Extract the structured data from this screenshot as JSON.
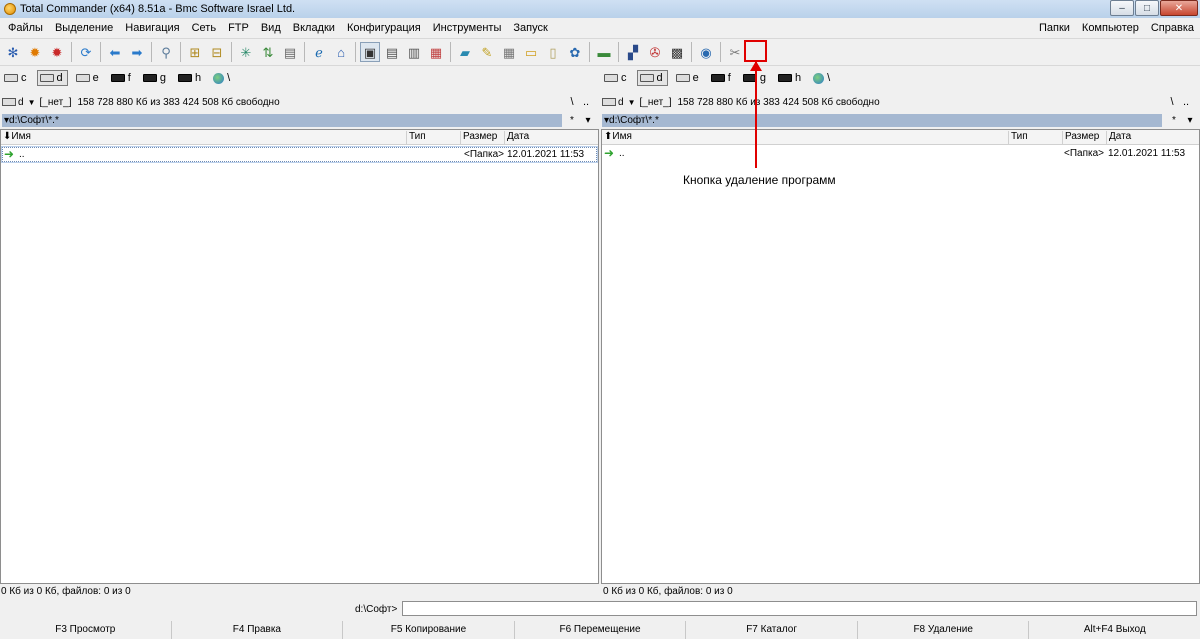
{
  "window": {
    "title": "Total Commander (x64) 8.51a - Bmc Software Israel Ltd.",
    "minimize": "–",
    "maximize": "□",
    "close": "✕"
  },
  "menu": {
    "left": [
      "Файлы",
      "Выделение",
      "Навигация",
      "Сеть",
      "FTP",
      "Вид",
      "Вкладки",
      "Конфигурация",
      "Инструменты",
      "Запуск"
    ],
    "right": [
      "Папки",
      "Компьютер",
      "Справка"
    ]
  },
  "toolbar": {
    "icons": [
      "gear-blue-icon",
      "gear-orange-icon",
      "gear-red-icon",
      "refresh-icon",
      "back-arrow-icon",
      "forward-arrow-icon",
      "search-icon",
      "pack-icon",
      "unpack-icon",
      "sync-icon",
      "compare-icon",
      "notepad-icon",
      "ie-icon",
      "ftp-icon",
      "view-mode-icon",
      "list-icon",
      "brief-icon",
      "thumbnails-icon",
      "ruler-icon",
      "paint-icon",
      "calc-icon",
      "notes-icon",
      "doc-icon",
      "network-icon",
      "hardware-icon",
      "windows-icon",
      "uninstall-icon",
      "terminal-icon",
      "globe-icon",
      "tools-icon"
    ],
    "glyphs": [
      "✻",
      "✹",
      "✹",
      "⟳",
      "⬅",
      "➡",
      "⚲",
      "⊞",
      "⊟",
      "✳",
      "⇅",
      "▤",
      "ℯ",
      "⌂",
      "▣",
      "▤",
      "▥",
      "▦",
      "▰",
      "✎",
      "▦",
      "▭",
      "▯",
      "✿",
      "▬",
      "▞",
      "✇",
      "▩",
      "◉",
      "✂"
    ]
  },
  "left_panel": {
    "drives": [
      {
        "letter": "c",
        "type": "hdd"
      },
      {
        "letter": "d",
        "type": "hdd",
        "active": true
      },
      {
        "letter": "e",
        "type": "hdd"
      },
      {
        "letter": "f",
        "type": "cd"
      },
      {
        "letter": "g",
        "type": "cd"
      },
      {
        "letter": "h",
        "type": "cd"
      },
      {
        "letter": "\\",
        "type": "net"
      }
    ],
    "drive_combo": "d",
    "volume_label": "[_нет_]",
    "free_space": "158 728 880 Кб из 383 424 508 Кб свободно",
    "root_btn": "\\",
    "up_btn": "..",
    "path": "▾d:\\Софт\\*.*",
    "star": "*",
    "dropdown": "▾",
    "columns": {
      "name": "⬇Имя",
      "type": "Тип",
      "size": "Размер",
      "date": "Дата"
    },
    "rows": [
      {
        "name": "..",
        "size": "<Папка>",
        "date": "12.01.2021 11:53"
      }
    ],
    "status": "0 Кб из 0 Кб, файлов: 0 из 0"
  },
  "right_panel": {
    "drives": [
      {
        "letter": "c",
        "type": "hdd"
      },
      {
        "letter": "d",
        "type": "hdd",
        "active": true
      },
      {
        "letter": "e",
        "type": "hdd"
      },
      {
        "letter": "f",
        "type": "cd"
      },
      {
        "letter": "g",
        "type": "cd"
      },
      {
        "letter": "h",
        "type": "cd"
      },
      {
        "letter": "\\",
        "type": "net"
      }
    ],
    "drive_combo": "d",
    "volume_label": "[_нет_]",
    "free_space": "158 728 880 Кб из 383 424 508 Кб свободно",
    "root_btn": "\\",
    "up_btn": "..",
    "path": "▾d:\\Софт\\*.*",
    "star": "*",
    "dropdown": "▾",
    "columns": {
      "name": "⬆Имя",
      "type": "Тип",
      "size": "Размер",
      "date": "Дата"
    },
    "rows": [
      {
        "name": "..",
        "size": "<Папка>",
        "date": "12.01.2021 11:53"
      }
    ],
    "status": "0 Кб из 0 Кб, файлов: 0 из 0"
  },
  "command_line": {
    "label": "d:\\Софт>",
    "value": ""
  },
  "fkeys": [
    "F3 Просмотр",
    "F4 Правка",
    "F5 Копирование",
    "F6 Перемещение",
    "F7 Каталог",
    "F8 Удаление",
    "Alt+F4 Выход"
  ],
  "annotation": {
    "text": "Кнопка удаление программ",
    "color": "#e00000"
  }
}
